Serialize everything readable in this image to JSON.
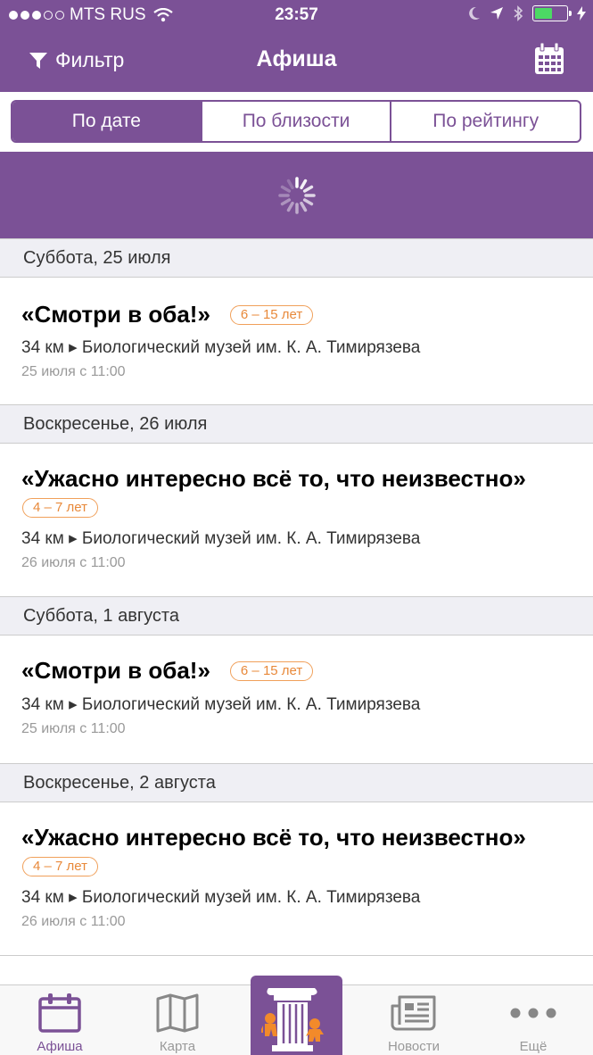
{
  "status_bar": {
    "carrier": "MTS RUS",
    "time": "23:57"
  },
  "nav": {
    "filter_label": "Фильтр",
    "title": "Афиша"
  },
  "segments": [
    {
      "label": "По дате",
      "active": true
    },
    {
      "label": "По близости",
      "active": false
    },
    {
      "label": "По рейтингу",
      "active": false
    }
  ],
  "sections": [
    {
      "header": "Суббота, 25 июля",
      "title": "«Смотри в оба!»",
      "age": "6 – 15 лет",
      "place": "34 км ▸ Биологический музей им. К. А. Тимирязева",
      "when": "25 июля с 11:00"
    },
    {
      "header": "Воскресенье, 26 июля",
      "title": "«Ужасно интересно всё то, что неизвестно»",
      "age": "4 – 7 лет",
      "place": "34 км ▸ Биологический музей им. К. А. Тимирязева",
      "when": "26 июля с 11:00"
    },
    {
      "header": "Суббота, 1 августа",
      "title": "«Смотри в оба!»",
      "age": "6 – 15 лет",
      "place": "34 км ▸ Биологический музей им. К. А. Тимирязева",
      "when": "25 июля с 11:00"
    },
    {
      "header": "Воскресенье, 2 августа",
      "title": "«Ужасно интересно всё то, что неизвестно»",
      "age": "4 – 7 лет",
      "place": "34 км ▸ Биологический музей им. К. А. Тимирязева",
      "when": "26 июля с 11:00"
    }
  ],
  "tabbar": {
    "afisha": "Афиша",
    "map": "Карта",
    "news": "Новости",
    "more": "Ещё"
  },
  "colors": {
    "brand": "#7b5196",
    "age_badge": "#e8893a",
    "section_bg": "#efeff4"
  },
  "icons": [
    "filter-icon",
    "calendar-icon",
    "spinner-icon",
    "map-icon",
    "museum-column-icon",
    "news-icon",
    "more-icon"
  ]
}
